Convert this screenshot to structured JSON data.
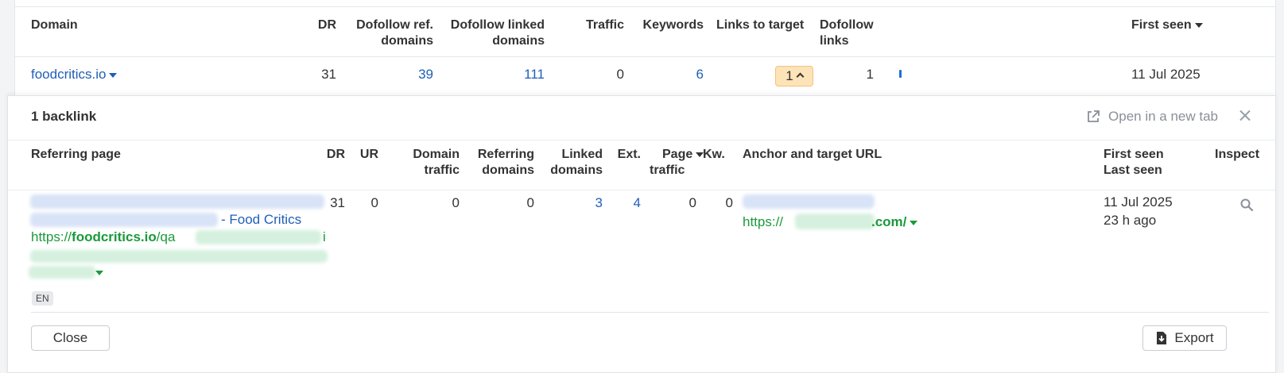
{
  "outer_table": {
    "headers": {
      "domain": "Domain",
      "dr": "DR",
      "dofollow_ref_1": "Dofollow ref.",
      "dofollow_ref_2": "domains",
      "dofollow_linked_1": "Dofollow linked",
      "dofollow_linked_2": "domains",
      "traffic": "Traffic",
      "keywords": "Keywords",
      "links_to_target": "Links to target",
      "dofollow_links_1": "Dofollow",
      "dofollow_links_2": "links",
      "first_seen": "First seen"
    },
    "row": {
      "domain": "foodcritics.io",
      "dr": "31",
      "dofollow_ref_domains": "39",
      "dofollow_linked_domains": "111",
      "traffic": "0",
      "keywords": "6",
      "links_to_target": "1",
      "dofollow_links": "1",
      "first_seen": "11 Jul 2025"
    }
  },
  "panel": {
    "title": "1 backlink",
    "open_new_tab": "Open in a new tab",
    "headers": {
      "referring_page": "Referring page",
      "dr": "DR",
      "ur": "UR",
      "domain_traffic_1": "Domain",
      "domain_traffic_2": "traffic",
      "referring_domains_1": "Referring",
      "referring_domains_2": "domains",
      "linked_domains_1": "Linked",
      "linked_domains_2": "domains",
      "ext": "Ext.",
      "page_traffic_1": "Page",
      "page_traffic_2": "traffic",
      "kw": "Kw.",
      "anchor_target": "Anchor and target URL",
      "first_seen": "First seen",
      "last_seen": "Last seen",
      "inspect": "Inspect"
    },
    "row": {
      "page_title_suffix": "- Food Critics",
      "url_prefix": "https://",
      "url_domain": "foodcritics.io",
      "url_path": "/qa",
      "url_tail": "i",
      "language": "EN",
      "dr": "31",
      "ur": "0",
      "domain_traffic": "0",
      "referring_domains": "0",
      "linked_domains": "3",
      "ext": "4",
      "page_traffic": "0",
      "kw": "0",
      "target_prefix": "https://",
      "target_suffix": ".com/",
      "first_seen": "11 Jul 2025",
      "last_seen": "23 h ago"
    },
    "buttons": {
      "close": "Close",
      "export": "Export"
    }
  },
  "colors": {
    "link_blue": "#1f5fb8",
    "url_green": "#1a9a3a",
    "badge_orange": "#fde3b8"
  }
}
